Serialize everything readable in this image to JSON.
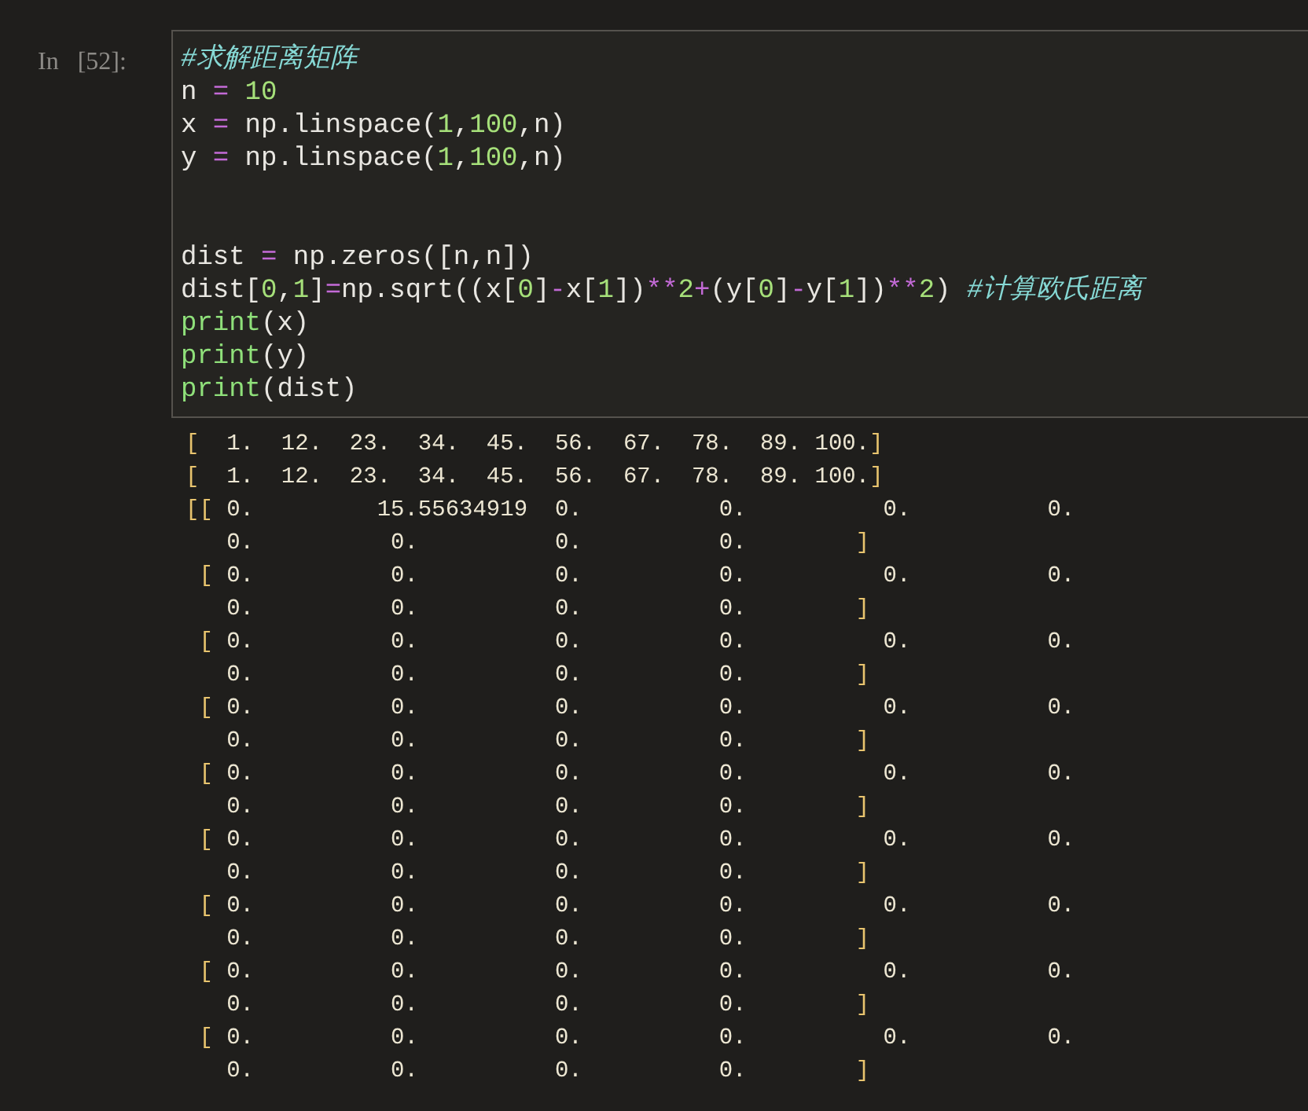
{
  "cell": {
    "prompt": "In [52]:",
    "code_lines": [
      {
        "tokens": [
          {
            "kind": "comment",
            "text": "#求解距离矩阵"
          }
        ]
      },
      {
        "tokens": [
          {
            "kind": "plain",
            "text": "n "
          },
          {
            "kind": "op",
            "text": "="
          },
          {
            "kind": "num",
            "text": " 10"
          }
        ]
      },
      {
        "tokens": [
          {
            "kind": "plain",
            "text": "x "
          },
          {
            "kind": "op",
            "text": "="
          },
          {
            "kind": "plain",
            "text": " np.linspace("
          },
          {
            "kind": "num",
            "text": "1"
          },
          {
            "kind": "plain",
            "text": ","
          },
          {
            "kind": "num",
            "text": "100"
          },
          {
            "kind": "plain",
            "text": ",n)"
          }
        ]
      },
      {
        "tokens": [
          {
            "kind": "plain",
            "text": "y "
          },
          {
            "kind": "op",
            "text": "="
          },
          {
            "kind": "plain",
            "text": " np.linspace("
          },
          {
            "kind": "num",
            "text": "1"
          },
          {
            "kind": "plain",
            "text": ","
          },
          {
            "kind": "num",
            "text": "100"
          },
          {
            "kind": "plain",
            "text": ",n)"
          }
        ]
      },
      {
        "kind": "blank"
      },
      {
        "kind": "blank"
      },
      {
        "tokens": [
          {
            "kind": "plain",
            "text": "dist "
          },
          {
            "kind": "op",
            "text": "="
          },
          {
            "kind": "plain",
            "text": " np.zeros([n,n])"
          }
        ]
      },
      {
        "tokens": [
          {
            "kind": "plain",
            "text": "dist["
          },
          {
            "kind": "num",
            "text": "0"
          },
          {
            "kind": "plain",
            "text": ","
          },
          {
            "kind": "num",
            "text": "1"
          },
          {
            "kind": "plain",
            "text": "]"
          },
          {
            "kind": "op",
            "text": "="
          },
          {
            "kind": "plain",
            "text": "np.sqrt((x["
          },
          {
            "kind": "num",
            "text": "0"
          },
          {
            "kind": "plain",
            "text": "]"
          },
          {
            "kind": "op",
            "text": "-"
          },
          {
            "kind": "plain",
            "text": "x["
          },
          {
            "kind": "num",
            "text": "1"
          },
          {
            "kind": "plain",
            "text": "])"
          },
          {
            "kind": "op",
            "text": "**"
          },
          {
            "kind": "num",
            "text": "2"
          },
          {
            "kind": "op",
            "text": "+"
          },
          {
            "kind": "plain",
            "text": "(y["
          },
          {
            "kind": "num",
            "text": "0"
          },
          {
            "kind": "plain",
            "text": "]"
          },
          {
            "kind": "op",
            "text": "-"
          },
          {
            "kind": "plain",
            "text": "y["
          },
          {
            "kind": "num",
            "text": "1"
          },
          {
            "kind": "plain",
            "text": "])"
          },
          {
            "kind": "op",
            "text": "**"
          },
          {
            "kind": "num",
            "text": "2"
          },
          {
            "kind": "plain",
            "text": ") "
          },
          {
            "kind": "comment",
            "text": "#计算欧氏距离"
          }
        ]
      },
      {
        "tokens": [
          {
            "kind": "builtin",
            "text": "print"
          },
          {
            "kind": "plain",
            "text": "(x)"
          }
        ]
      },
      {
        "tokens": [
          {
            "kind": "builtin",
            "text": "print"
          },
          {
            "kind": "plain",
            "text": "(y)"
          }
        ]
      },
      {
        "tokens": [
          {
            "kind": "builtin",
            "text": "print"
          },
          {
            "kind": "plain",
            "text": "(dist)"
          }
        ]
      }
    ],
    "output_lines": [
      "[  1.  12.  23.  34.  45.  56.  67.  78.  89. 100.]",
      "[  1.  12.  23.  34.  45.  56.  67.  78.  89. 100.]",
      "[[ 0.         15.55634919  0.          0.          0.          0.",
      "   0.          0.          0.          0.        ]",
      " [ 0.          0.          0.          0.          0.          0.",
      "   0.          0.          0.          0.        ]",
      " [ 0.          0.          0.          0.          0.          0.",
      "   0.          0.          0.          0.        ]",
      " [ 0.          0.          0.          0.          0.          0.",
      "   0.          0.          0.          0.        ]",
      " [ 0.          0.          0.          0.          0.          0.",
      "   0.          0.          0.          0.        ]",
      " [ 0.          0.          0.          0.          0.          0.",
      "   0.          0.          0.          0.        ]",
      " [ 0.          0.          0.          0.          0.          0.",
      "   0.          0.          0.          0.        ]",
      " [ 0.          0.          0.          0.          0.          0.",
      "   0.          0.          0.          0.        ]",
      " [ 0.          0.          0.          0.          0.          0.",
      "   0.          0.          0.          0.        ]"
    ]
  }
}
